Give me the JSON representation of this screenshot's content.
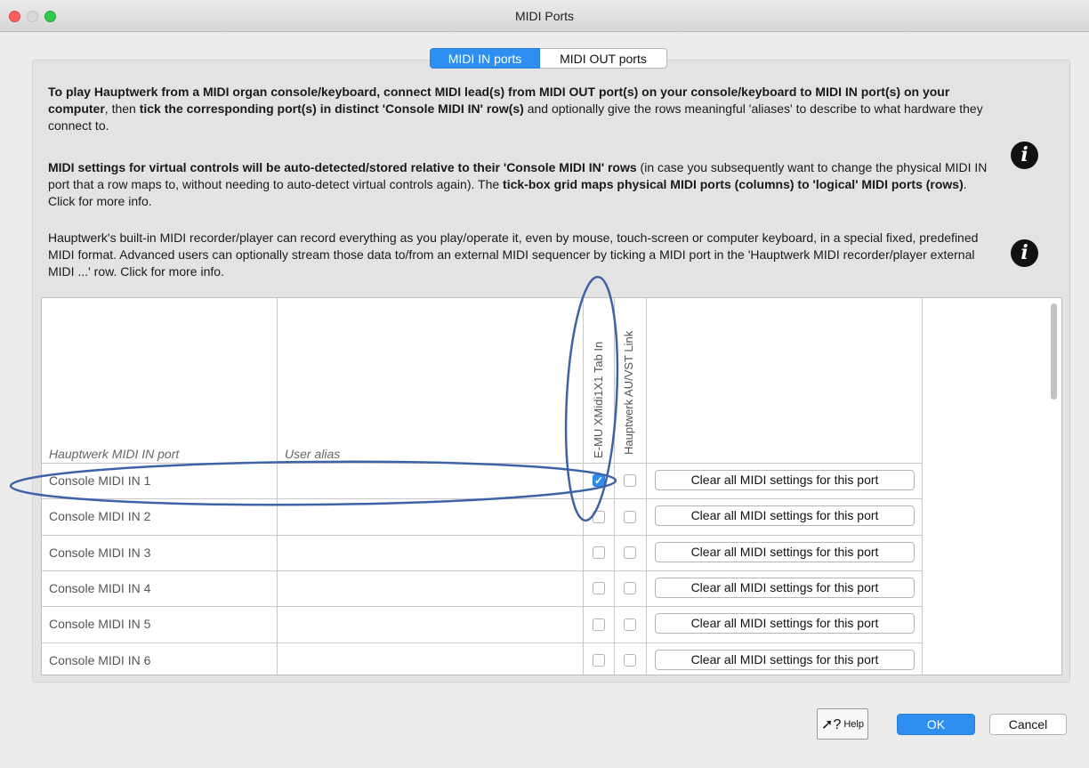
{
  "window": {
    "title": "MIDI Ports"
  },
  "tabs": [
    {
      "label": "MIDI IN ports",
      "active": true
    },
    {
      "label": "MIDI OUT ports",
      "active": false
    }
  ],
  "paragraph1": {
    "b1": "To play Hauptwerk from a MIDI organ console/keyboard, connect MIDI lead(s) from MIDI OUT port(s) on your console/keyboard to MIDI IN port(s) on your computer",
    "t1": ", then ",
    "b2": "tick the corresponding port(s) in distinct 'Console MIDI IN' row(s)",
    "t2": " and optionally give the rows meaningful 'aliases' to describe to what hardware they connect to."
  },
  "paragraph2": {
    "b1": "MIDI settings for virtual controls will be auto-detected/stored relative to their 'Console MIDI IN' rows",
    "t1": " (in case you subsequently want to change the physical MIDI IN port that a row maps to, without needing to auto-detect virtual controls again). The ",
    "b2": "tick-box grid maps physical MIDI ports (columns) to 'logical' MIDI ports (rows)",
    "t2": ". Click for more info."
  },
  "paragraph3": {
    "text": "Hauptwerk's built-in MIDI recorder/player can record everything as you play/operate it, even by mouse, touch-screen or computer keyboard, in a special fixed, predefined MIDI format. Advanced users can optionally stream those data to/from an external MIDI sequencer by ticking a MIDI port in the 'Hauptwerk MIDI recorder/player external MIDI ...' row. Click for more info."
  },
  "info_icon_glyph": "i",
  "grid": {
    "headers": {
      "port": "Hauptwerk MIDI IN port",
      "alias": "User alias",
      "col1": "E-MU XMidi1X1 Tab In",
      "col2": "Hauptwerk AU/VST Link"
    },
    "rows": [
      {
        "label": "Console MIDI IN 1",
        "col1": true,
        "col2": false,
        "button": "Clear all MIDI settings for this port"
      },
      {
        "label": "Console MIDI IN 2",
        "col1": false,
        "col2": false,
        "button": "Clear all MIDI settings for this port"
      },
      {
        "label": "Console MIDI IN 3",
        "col1": false,
        "col2": false,
        "button": "Clear all MIDI settings for this port"
      },
      {
        "label": "Console MIDI IN 4",
        "col1": false,
        "col2": false,
        "button": "Clear all MIDI settings for this port"
      },
      {
        "label": "Console MIDI IN 5",
        "col1": false,
        "col2": false,
        "button": "Clear all MIDI settings for this port"
      },
      {
        "label": "Console MIDI IN 6",
        "col1": false,
        "col2": false,
        "button": "Clear all MIDI settings for this port"
      }
    ]
  },
  "buttons": {
    "help": "Help",
    "ok": "OK",
    "cancel": "Cancel"
  },
  "colors": {
    "accent": "#2f8ff0",
    "annotation": "#3d63a6"
  }
}
